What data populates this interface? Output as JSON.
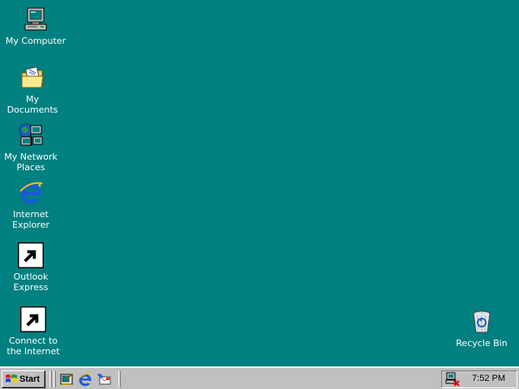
{
  "desktop": {
    "background_color": "#008080",
    "icons": [
      {
        "label": "My Computer",
        "icon": "my-computer-icon"
      },
      {
        "label": "My Documents",
        "icon": "folder-documents-icon"
      },
      {
        "label": "My Network\nPlaces",
        "icon": "network-places-icon"
      },
      {
        "label": "Internet\nExplorer",
        "icon": "internet-explorer-icon"
      },
      {
        "label": "Outlook\nExpress",
        "icon": "outlook-express-icon"
      },
      {
        "label": "Connect to\nthe Internet",
        "icon": "connect-internet-icon"
      },
      {
        "label": "Recycle Bin",
        "icon": "recycle-bin-icon"
      }
    ]
  },
  "taskbar": {
    "start_label": "Start",
    "quick_launch": [
      {
        "icon": "show-desktop-icon"
      },
      {
        "icon": "internet-explorer-icon"
      },
      {
        "icon": "outlook-express-icon"
      }
    ],
    "tray": {
      "network_icon": "network-disconnected-icon",
      "clock": "7:52 PM"
    }
  }
}
